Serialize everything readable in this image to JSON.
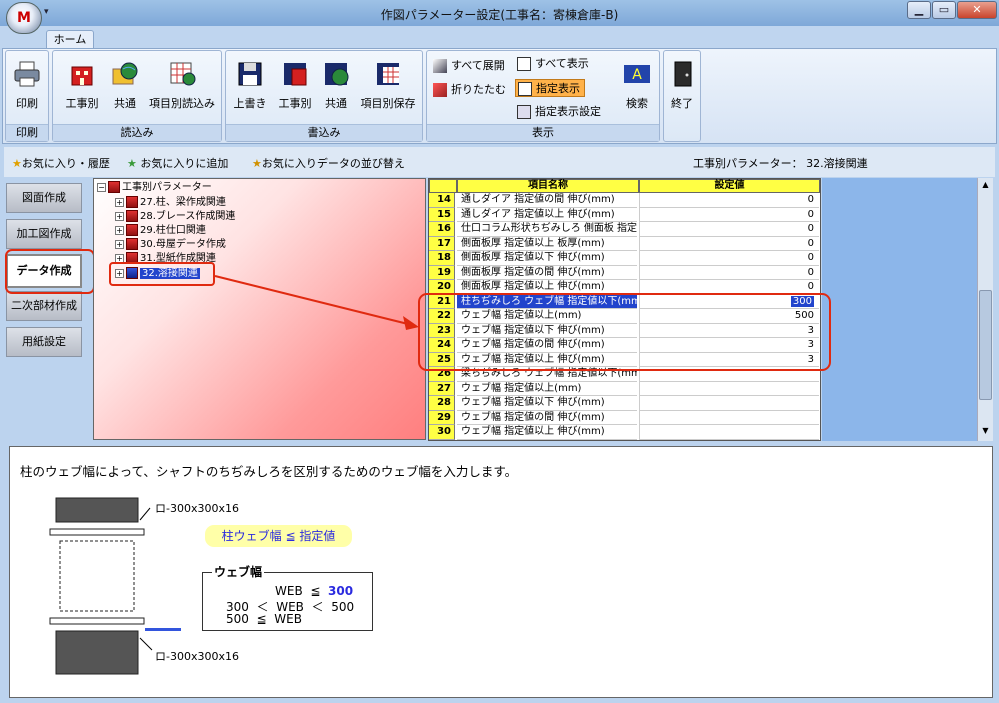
{
  "window": {
    "title": "作図パラメーター設定(工事名：寄棟倉庫-B)",
    "min": "▁",
    "max": "▭",
    "close": "✕",
    "qat": "▾"
  },
  "tabs": [
    {
      "label": "ホーム"
    }
  ],
  "ribbon": {
    "groups": {
      "print": "印刷",
      "load": "読込み",
      "save": "書込み",
      "display": "表示"
    },
    "print": "印刷",
    "load": [
      "工事別",
      "共通",
      "項目別読込み"
    ],
    "save": [
      "上書き",
      "工事別",
      "共通",
      "項目別保存"
    ],
    "expand_all": "すべて展開",
    "collapse": "折りたたむ",
    "show_all": "すべて表示",
    "show_selected": "指定表示",
    "display_settings": "指定表示設定",
    "search": "検索",
    "exit": "終了"
  },
  "favorites": {
    "history": "お気に入り・履歴",
    "add": "お気に入りに追加",
    "sort": "お気に入りデータの並び替え",
    "current_label": "工事別パラメーター：",
    "current_value": "32.溶接関連"
  },
  "sidebar": [
    {
      "label": "図面作成"
    },
    {
      "label": "加工図作成"
    },
    {
      "label": "データ作成",
      "active": true
    },
    {
      "label": "二次部材作成"
    },
    {
      "label": "用紙設定"
    }
  ],
  "tree": {
    "root": "工事別パラメーター",
    "items": [
      "27.柱、梁作成関連",
      "28.ブレース作成関連",
      "29.柱仕口関連",
      "30.母屋データ作成",
      "31.型紙作成関連",
      "32.溶接関連"
    ]
  },
  "grid": {
    "headers": {
      "name": "項目名称",
      "value": "設定値"
    },
    "rows": [
      {
        "no": "14",
        "name": "通しダイア 指定値の間 伸び(mm)",
        "value": "0"
      },
      {
        "no": "15",
        "name": "通しダイア 指定値以上 伸び(mm)",
        "value": "0"
      },
      {
        "no": "16",
        "name": "仕口コラム形状ちぢみしろ 側面板 指定",
        "value": "0"
      },
      {
        "no": "17",
        "name": "側面板厚 指定値以上 板厚(mm)",
        "value": "0"
      },
      {
        "no": "18",
        "name": "側面板厚 指定値以下 伸び(mm)",
        "value": "0"
      },
      {
        "no": "19",
        "name": "側面板厚 指定値の間 伸び(mm)",
        "value": "0"
      },
      {
        "no": "20",
        "name": "側面板厚 指定値以上 伸び(mm)",
        "value": "0"
      },
      {
        "no": "21",
        "name": "柱ちぢみしろ ウェブ幅 指定値以下(mm",
        "value": "300",
        "selected": true
      },
      {
        "no": "22",
        "name": "ウェブ幅 指定値以上(mm)",
        "value": "500"
      },
      {
        "no": "23",
        "name": "ウェブ幅 指定値以下 伸び(mm)",
        "value": "3"
      },
      {
        "no": "24",
        "name": "ウェブ幅 指定値の間 伸び(mm)",
        "value": "3"
      },
      {
        "no": "25",
        "name": "ウェブ幅 指定値以上 伸び(mm)",
        "value": "3"
      },
      {
        "no": "26",
        "name": "梁ちぢみしろ ウェブ幅 指定値以下(mm",
        "value": ""
      },
      {
        "no": "27",
        "name": "ウェブ幅 指定値以上(mm)",
        "value": ""
      },
      {
        "no": "28",
        "name": "ウェブ幅 指定値以下 伸び(mm)",
        "value": ""
      },
      {
        "no": "29",
        "name": "ウェブ幅 指定値の間 伸び(mm)",
        "value": ""
      },
      {
        "no": "30",
        "name": "ウェブ幅 指定値以上 伸び(mm)",
        "value": ""
      }
    ]
  },
  "description": {
    "text": "柱のウェブ幅によって、シャフトのちぢみしろを区別するためのウェブ幅を入力します。",
    "top_label": "ロ-300x300x16",
    "bottom_label": "ロ-300x300x16",
    "formula": "柱ウェブ幅 ≦ 指定値",
    "box_title": "ウェブ幅",
    "line1": [
      "WEB",
      "≦",
      "300"
    ],
    "line2": [
      "300",
      "＜",
      "WEB",
      "＜",
      "500"
    ],
    "line3": [
      "500",
      "≦",
      "WEB"
    ]
  },
  "colors": {
    "tree_gradient_end": "#ff7f7f",
    "grid_header": "#ffff44",
    "selection": "#2244cc",
    "highlight": "#e02a10",
    "accent_value": "#2a2adf"
  }
}
